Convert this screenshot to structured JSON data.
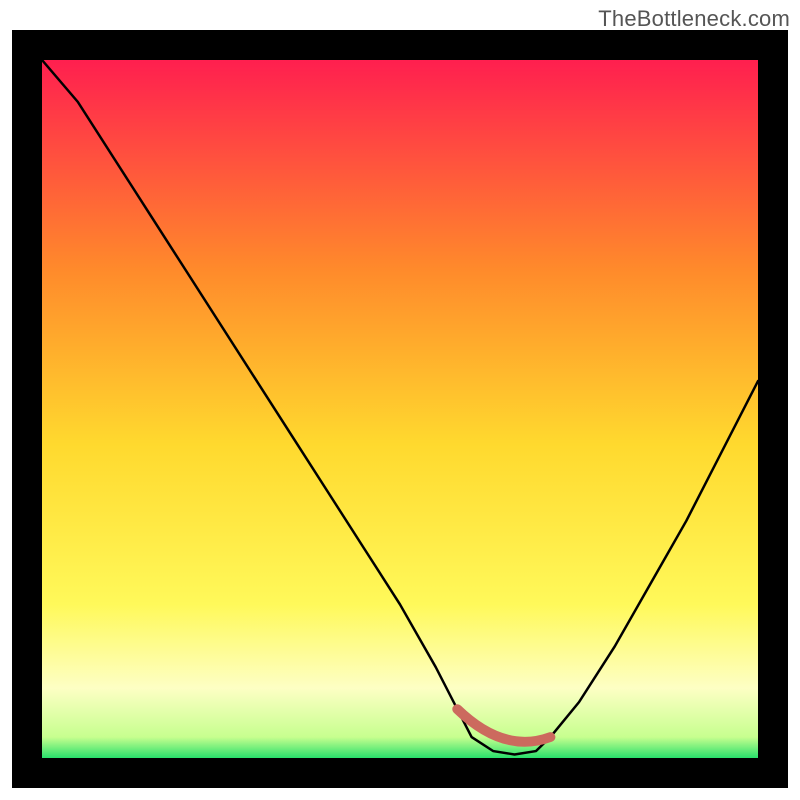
{
  "watermark": "TheBottleneck.com",
  "colors": {
    "top": "#ff1f4f",
    "upper_mid": "#ff8a2b",
    "mid": "#ffd92e",
    "lower_mid": "#fff95a",
    "pale_band": "#fdffc4",
    "green": "#28e06b",
    "accent": "#cc6a5e",
    "curve": "#000000",
    "border": "#000000"
  },
  "chart_data": {
    "type": "line",
    "title": "",
    "xlabel": "",
    "ylabel": "",
    "xlim": [
      0,
      100
    ],
    "ylim": [
      0,
      100
    ],
    "grid": false,
    "legend": false,
    "series": [
      {
        "name": "curve",
        "x": [
          0,
          5,
          10,
          15,
          20,
          25,
          30,
          35,
          40,
          45,
          50,
          55,
          58,
          60,
          63,
          66,
          69,
          71,
          75,
          80,
          85,
          90,
          95,
          100
        ],
        "y": [
          100,
          94,
          86,
          78,
          70,
          62,
          54,
          46,
          38,
          30,
          22,
          13,
          7,
          3,
          1,
          0.5,
          1,
          3,
          8,
          16,
          25,
          34,
          44,
          54
        ]
      }
    ],
    "flat_region_x": [
      58,
      71
    ],
    "gradient_stops": [
      {
        "pos": 0.0,
        "color": "#ff1f4f"
      },
      {
        "pos": 0.3,
        "color": "#ff8a2b"
      },
      {
        "pos": 0.55,
        "color": "#ffd92e"
      },
      {
        "pos": 0.78,
        "color": "#fff95a"
      },
      {
        "pos": 0.9,
        "color": "#fdffc4"
      },
      {
        "pos": 0.97,
        "color": "#c7ff8f"
      },
      {
        "pos": 1.0,
        "color": "#28e06b"
      }
    ]
  }
}
